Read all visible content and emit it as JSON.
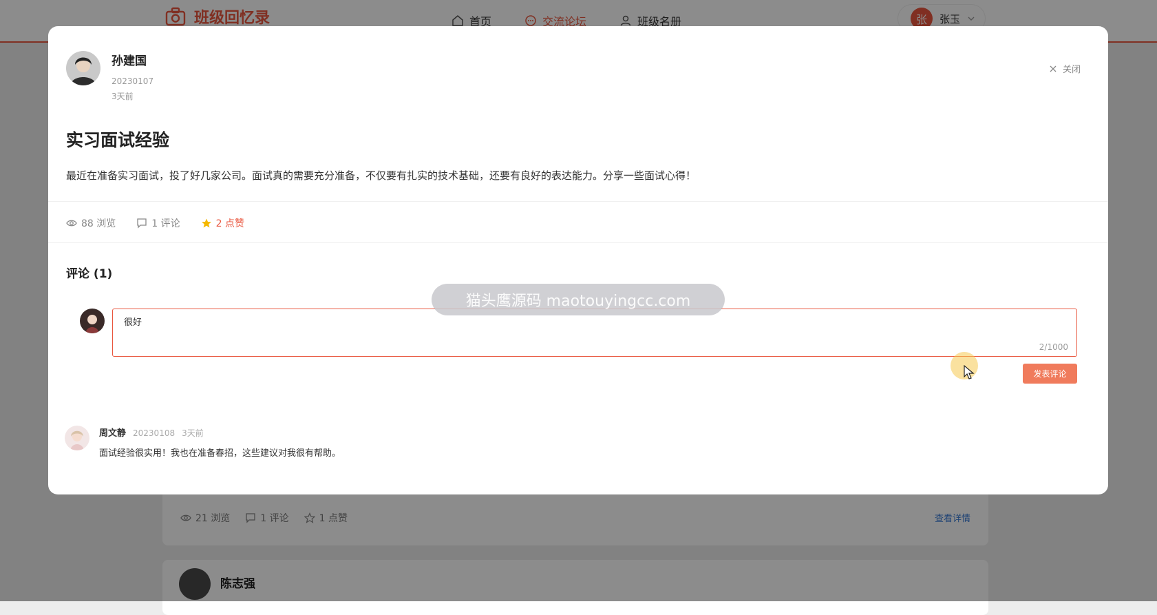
{
  "app": {
    "logo_text": "班级回忆录",
    "nav": [
      {
        "label": "首页",
        "icon": "home-icon",
        "active": false
      },
      {
        "label": "交流论坛",
        "icon": "chat-icon",
        "active": true
      },
      {
        "label": "班级名册",
        "icon": "user-icon",
        "active": false
      }
    ],
    "user": {
      "avatar_char": "张",
      "name": "张玉"
    },
    "accent": "#e9573f"
  },
  "background": {
    "card1": {
      "views": "21 浏览",
      "comments": "1 评论",
      "likes": "1 点赞",
      "detail_link": "查看详情"
    },
    "card2": {
      "author": "陈志强"
    }
  },
  "modal": {
    "author": {
      "name": "孙建国",
      "id": "20230107",
      "time": "3天前"
    },
    "close_label": "关闭",
    "title": "实习面试经验",
    "content": "最近在准备实习面试，投了好几家公司。面试真的需要充分准备，不仅要有扎实的技术基础，还要有良好的表达能力。分享一些面试心得！",
    "stats": {
      "views": "88 浏览",
      "comments": "1 评论",
      "likes": "2 点赞"
    },
    "comments_title": "评论 (1)",
    "comment_input": {
      "value": "很好",
      "counter": "2/1000"
    },
    "post_button": "发表评论",
    "watermark": "猫头鹰源码 maotouyingcc.com",
    "comments": [
      {
        "name": "周文静",
        "id": "20230108",
        "time": "3天前",
        "text": "面试经验很实用！我也在准备春招，这些建议对我很有帮助。"
      }
    ]
  }
}
